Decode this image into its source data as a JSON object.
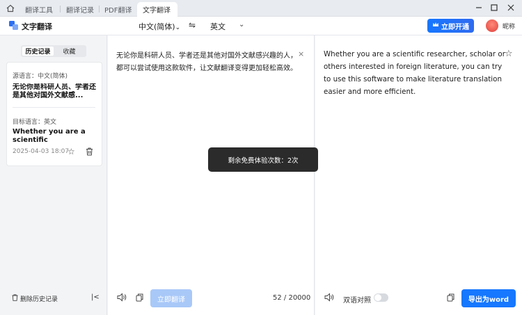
{
  "tabs": [
    {
      "label": "翻译工具"
    },
    {
      "label": "翻译记录"
    },
    {
      "label": "PDF翻译"
    },
    {
      "label": "文字翻译",
      "active": true,
      "close": "×"
    }
  ],
  "header": {
    "title": "文字翻译",
    "source_language": "中文(简体)",
    "swap_icon": "⇋",
    "target_language": "英文",
    "target_chevron": "⌄",
    "vip_button": "立即开通",
    "nickname": "昵称"
  },
  "sidebar": {
    "tabs": [
      "历史记录",
      "收藏"
    ],
    "record": {
      "source_label": "源语言：中文(简体)",
      "source_preview": "无论你是科研人员、学者还是其他对国外文献感...",
      "target_label": "目标语言：英文",
      "target_preview": "Whether you are a scientific researcher,...",
      "time": "2025-04-03 18:07"
    },
    "clear_history": "删除历史记录",
    "collapse": "|<"
  },
  "source": {
    "text": "无论你是科研人员、学者还是其他对国外文献感兴趣的人，都可以尝试使用这款软件，让文献翻译变得更加轻松高效。",
    "clear": "×",
    "translate_button": "立即翻译",
    "counter": "52 / 20000"
  },
  "target": {
    "text": "Whether you are a scientific researcher, scholar or others interested in foreign literature, you can try to use this software to make literature translation easier and more efficient.",
    "star": "☆",
    "bilingual_label": "双语对照",
    "bilingual_on": false,
    "export_button": "导出为word"
  },
  "toast": "剩余免费体验次数：2次",
  "colors": {
    "accent": "#1677ff",
    "accent_disabled": "#a8c8f8",
    "toast_bg": "#2b2b2b"
  }
}
